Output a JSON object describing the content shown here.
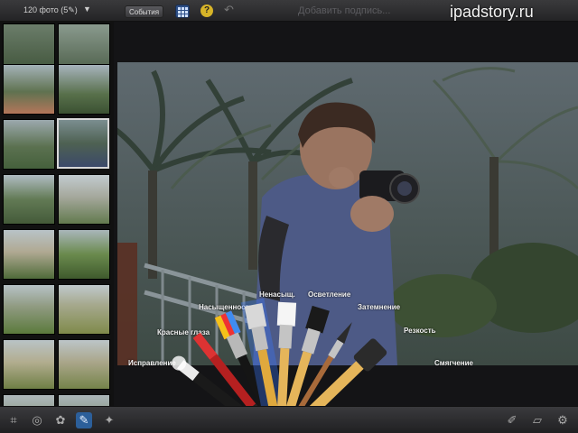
{
  "topbar": {
    "photo_count": "120 фото (5✎)",
    "events_label": "События",
    "caption_placeholder": "Добавить подпись...",
    "watermark": "ipadstory.ru"
  },
  "brush_tools": {
    "correction": "Исправление",
    "red_eye": "Красные глаза",
    "saturation": "Насыщенность",
    "desaturate": "Ненасыщ.",
    "lighten": "Осветление",
    "darken": "Затемнение",
    "sharpen": "Резкость",
    "soften": "Смягчение"
  },
  "icons": {
    "top": [
      "chevron-down-icon",
      "grid-icon",
      "help-icon",
      "undo-icon"
    ],
    "bottom": [
      "crop-icon",
      "exposure-icon",
      "color-palette-icon",
      "brushes-icon",
      "effects-icon",
      "paint-brush-icon",
      "eraser-icon",
      "settings-gear-icon"
    ]
  },
  "colors": {
    "accent": "#2c5f9a",
    "help": "#d7b428",
    "background": "#1b1b1d"
  }
}
